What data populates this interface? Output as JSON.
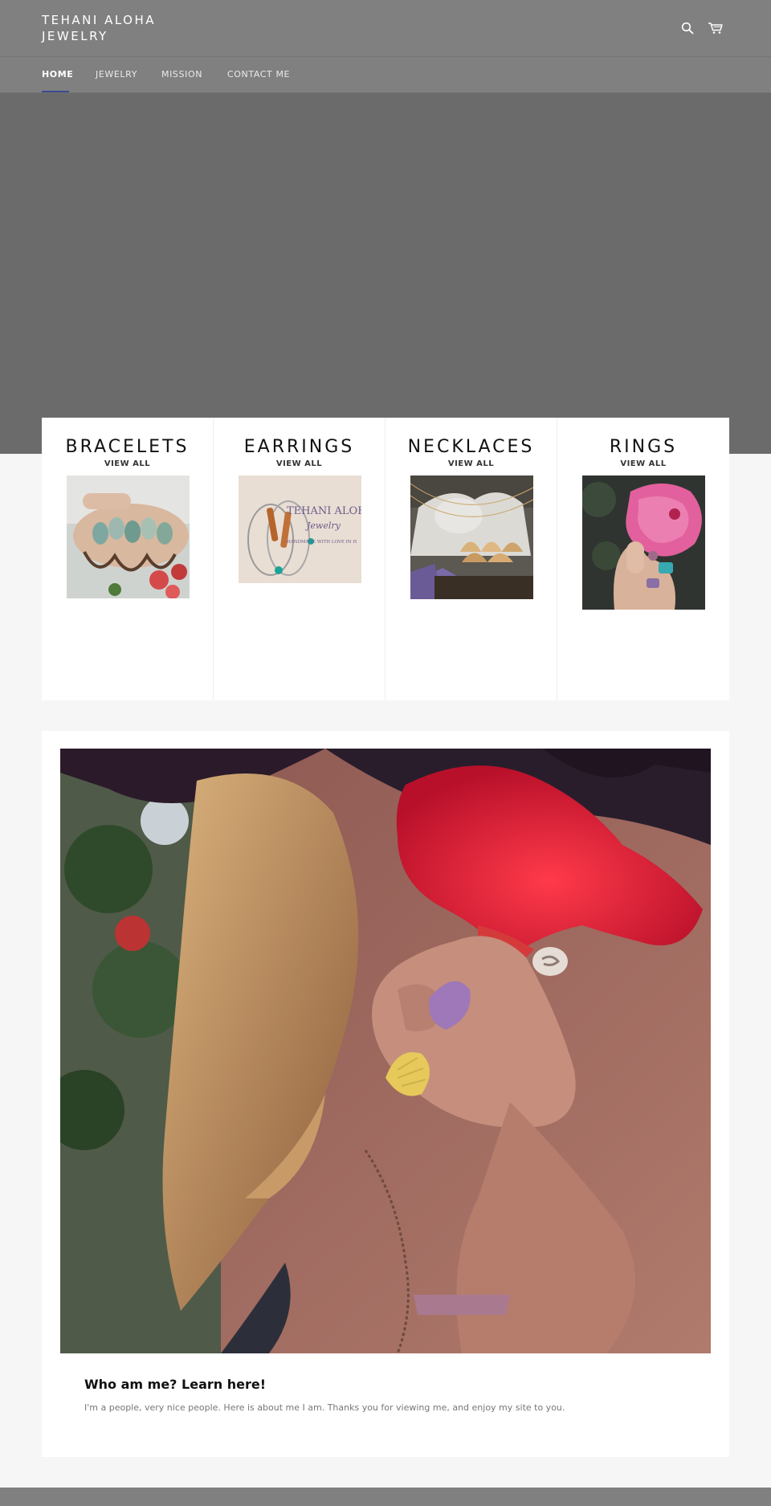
{
  "header": {
    "logo_line1": "TEHANI ALOHA",
    "logo_line2": "JEWELRY",
    "search_icon": "search-icon",
    "cart_icon": "cart-icon"
  },
  "nav": {
    "items": [
      {
        "label": "HOME",
        "active": true
      },
      {
        "label": "JEWELRY",
        "active": false
      },
      {
        "label": "MISSION",
        "active": false
      },
      {
        "label": "CONTACT ME",
        "active": false
      }
    ]
  },
  "collections": [
    {
      "title": "BRACELETS",
      "link": "VIEW ALL"
    },
    {
      "title": "EARRINGS",
      "link": "VIEW ALL",
      "image_text_1": "TEHANI ALOH",
      "image_text_2": "Jewelry",
      "image_text_3": "HANDMADE WITH LOVE IN H"
    },
    {
      "title": "NECKLACES",
      "link": "VIEW ALL"
    },
    {
      "title": "RINGS",
      "link": "VIEW ALL"
    }
  ],
  "feature": {
    "title": "Who am me? Learn here!",
    "text": "I'm a people, very nice people. Here is about me I am. Thanks you for viewing me, and enjoy my site to you."
  },
  "colors": {
    "header_bg": "#808080",
    "hero_bg": "#6b6b6b",
    "accent": "#3d4a8f",
    "page_bg": "#f6f6f6"
  }
}
